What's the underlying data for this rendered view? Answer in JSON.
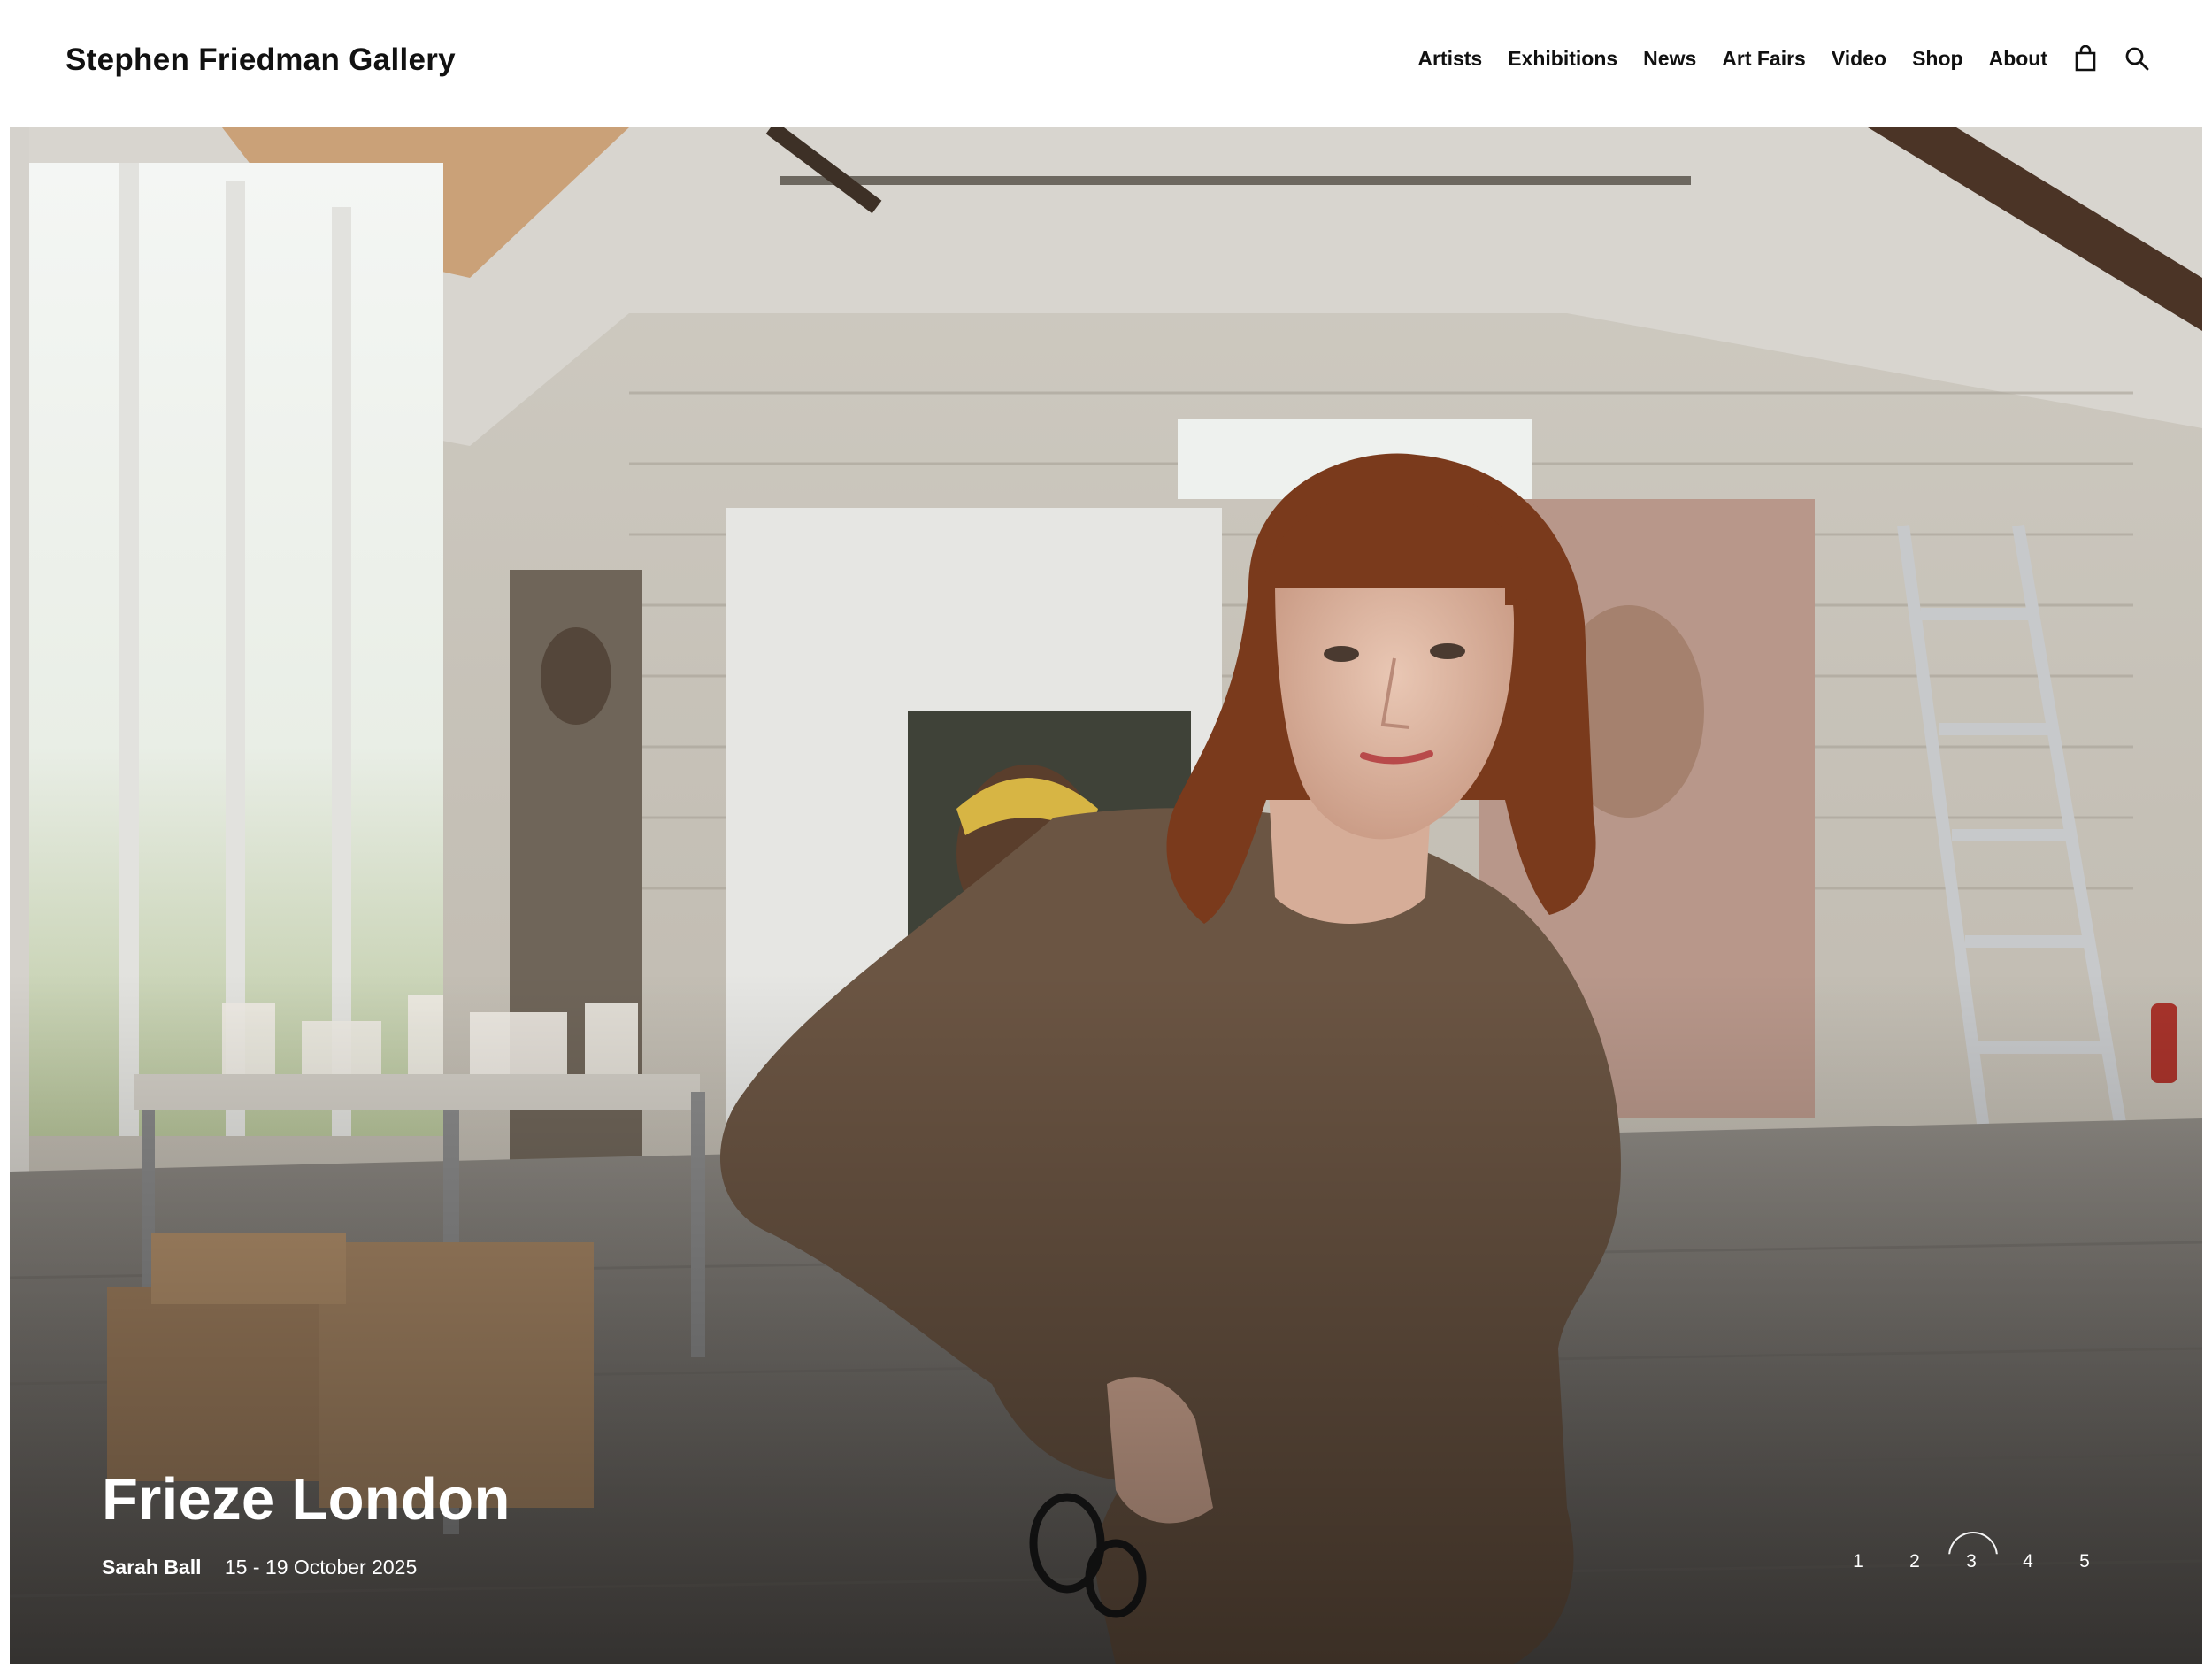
{
  "header": {
    "logo": "Stephen Friedman Gallery",
    "nav": [
      "Artists",
      "Exhibitions",
      "News",
      "Art Fairs",
      "Video",
      "Shop",
      "About"
    ],
    "icons": {
      "cart": "shopping-bag-icon",
      "search": "search-icon"
    }
  },
  "hero": {
    "title": "Frieze London",
    "artist": "Sarah Ball",
    "dates": "15 - 19 October 2025",
    "image": "artist-studio-portrait-photo",
    "pager": {
      "pages": [
        "1",
        "2",
        "3",
        "4",
        "5"
      ],
      "active": "3"
    }
  },
  "colors": {
    "text": "#111111",
    "overlay_text": "#ffffff",
    "sweater": "#6b5543",
    "hair": "#7a3a1c"
  }
}
